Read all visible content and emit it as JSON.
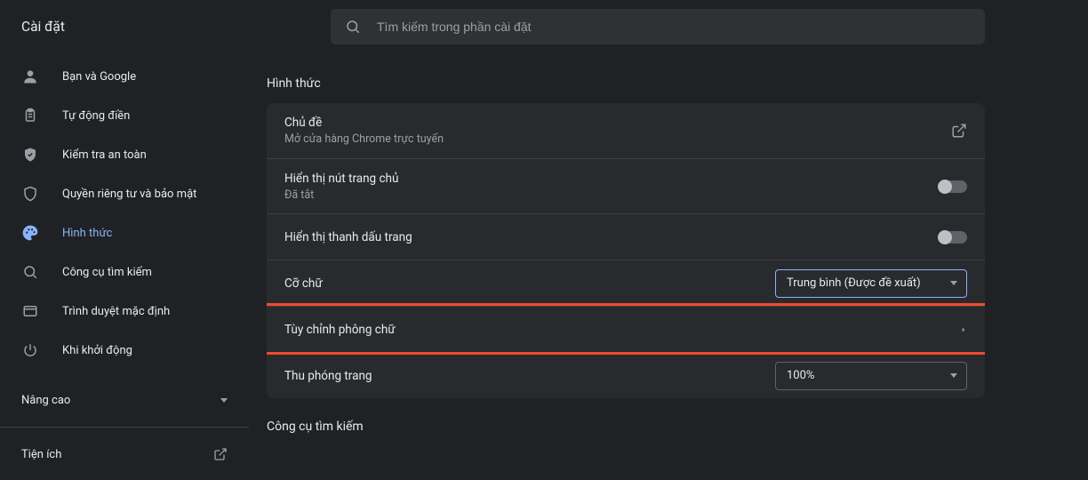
{
  "header": {
    "title": "Cài đặt"
  },
  "search": {
    "placeholder": "Tìm kiếm trong phần cài đặt"
  },
  "sidebar": {
    "items": [
      {
        "label": "Bạn và Google"
      },
      {
        "label": "Tự động điền"
      },
      {
        "label": "Kiểm tra an toàn"
      },
      {
        "label": "Quyền riêng tư và bảo mật"
      },
      {
        "label": "Hình thức"
      },
      {
        "label": "Công cụ tìm kiếm"
      },
      {
        "label": "Trình duyệt mặc định"
      },
      {
        "label": "Khi khởi động"
      }
    ],
    "advanced": "Nâng cao",
    "extensions": "Tiện ích"
  },
  "appearance": {
    "title": "Hình thức",
    "theme_title": "Chủ đề",
    "theme_sub": "Mở cửa hàng Chrome trực tuyến",
    "homebutton_title": "Hiển thị nút trang chủ",
    "homebutton_sub": "Đã tắt",
    "bookmarks_bar": "Hiển thị thanh dấu trang",
    "font_size_label": "Cỡ chữ",
    "font_size_value": "Trung bình (Được đề xuất)",
    "customize_fonts": "Tùy chỉnh phông chữ",
    "page_zoom_label": "Thu phóng trang",
    "page_zoom_value": "100%"
  },
  "search_engine": {
    "title": "Công cụ tìm kiếm"
  }
}
